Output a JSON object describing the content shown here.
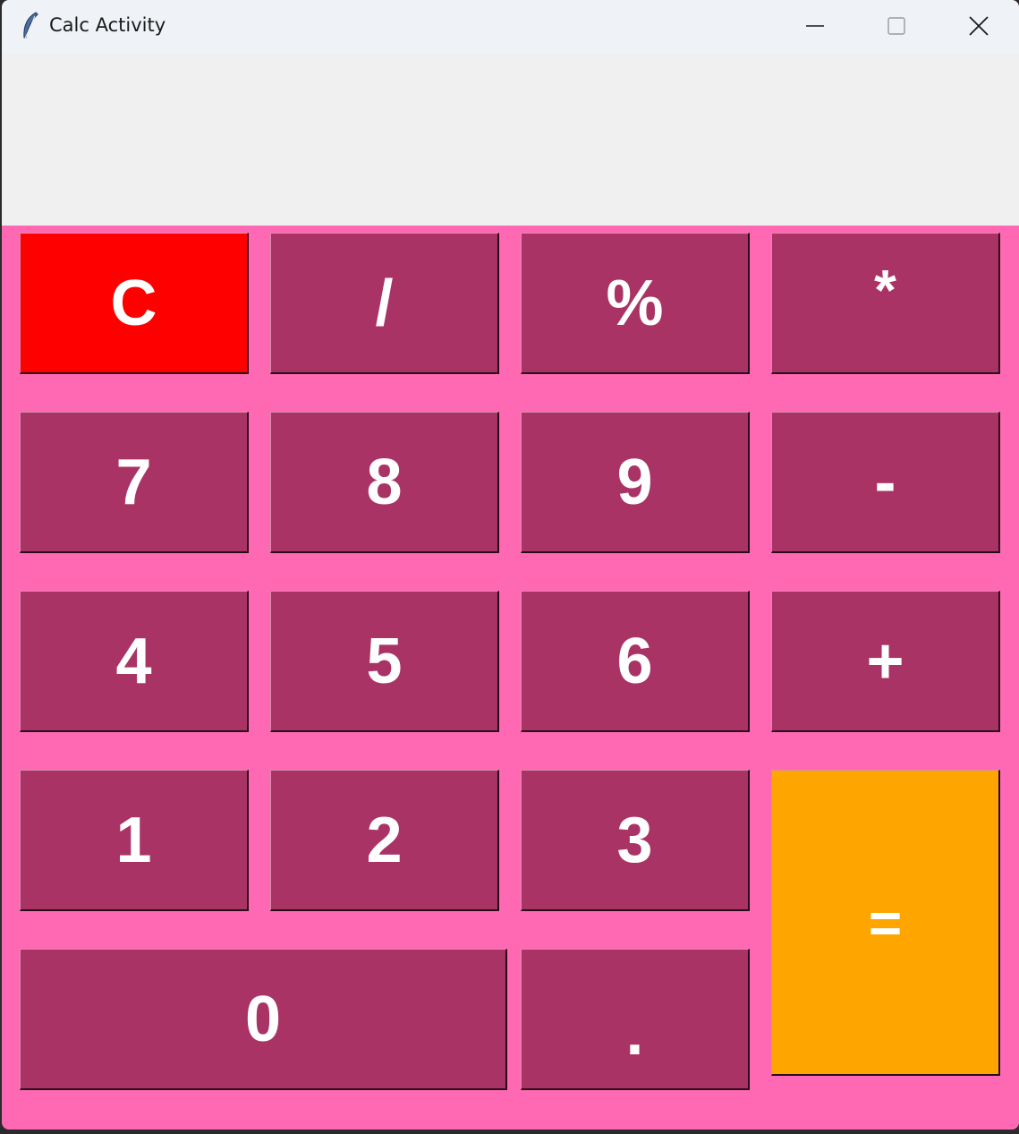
{
  "window": {
    "title": "Calc Activity"
  },
  "display": {
    "value": ""
  },
  "colors": {
    "background": "#ff69b4",
    "key": "#aa3366",
    "clear_key": "#ff0000",
    "equals_key": "#ffa500",
    "key_text": "#ffffff",
    "display_bg": "#f0f0f0"
  },
  "keys": {
    "clear": "C",
    "divide": "/",
    "percent": "%",
    "multiply": "*",
    "seven": "7",
    "eight": "8",
    "nine": "9",
    "minus": "-",
    "four": "4",
    "five": "5",
    "six": "6",
    "plus": "+",
    "one": "1",
    "two": "2",
    "three": "3",
    "equals": "=",
    "zero": "0",
    "decimal": "."
  },
  "icons": {
    "app": "feather-icon",
    "minimize": "minimize-icon",
    "maximize": "maximize-icon",
    "close": "close-icon"
  }
}
